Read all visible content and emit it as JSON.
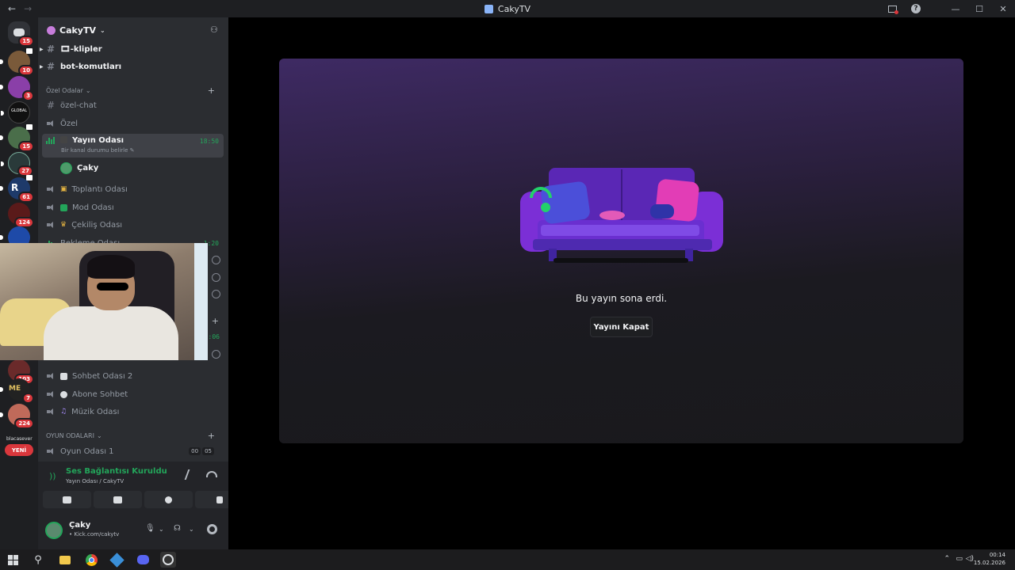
{
  "window": {
    "title": "CakyTV",
    "back": "←",
    "forward": "→"
  },
  "server_badges": [
    "15",
    "10",
    "3",
    "15",
    "27",
    "61",
    "124",
    "103",
    "7",
    "224"
  ],
  "server_text": "blacasever",
  "new_badge": "YENİ",
  "guild": {
    "name": "CakyTV"
  },
  "channels_top": [
    {
      "name": "🎞-klipler"
    },
    {
      "name": "bot-komutları"
    }
  ],
  "category_private": "Özel Odalar",
  "private_channels": [
    "özel-chat",
    "Özel"
  ],
  "active_voice": {
    "name": "Yayın Odası",
    "status": "Bir kanal durumu belirle",
    "time": "18:50"
  },
  "voice_user": "Çaky",
  "voice_channels": [
    "Toplantı Odası",
    "Mod Odası",
    "Çekiliş Odası",
    "Bekleme Odası"
  ],
  "partial_times": [
    "1:20",
    ":06"
  ],
  "voice_channels_2": [
    "Sohbet Odası 2",
    "Abone Sohbet",
    "Müzik Odası"
  ],
  "category_games": "OYUN ODALARI",
  "game_channel": {
    "name": "Oyun Odası 1",
    "count_a": "00",
    "count_b": "05"
  },
  "voice_status": {
    "title": "Ses Bağlantısı Kuruldu",
    "location": "Yayın Odası / CakyTV"
  },
  "user": {
    "name": "Çaky",
    "status": "• Kick.com/cakytv"
  },
  "stream": {
    "ended_text": "Bu yayın sona erdi.",
    "close_label": "Yayını Kapat"
  },
  "clock": {
    "time": "00:14",
    "date": "15.02.2026"
  },
  "colors": {
    "accent_green": "#23a55a",
    "danger": "#da373c",
    "couch_purple": "#6a2fd0"
  }
}
